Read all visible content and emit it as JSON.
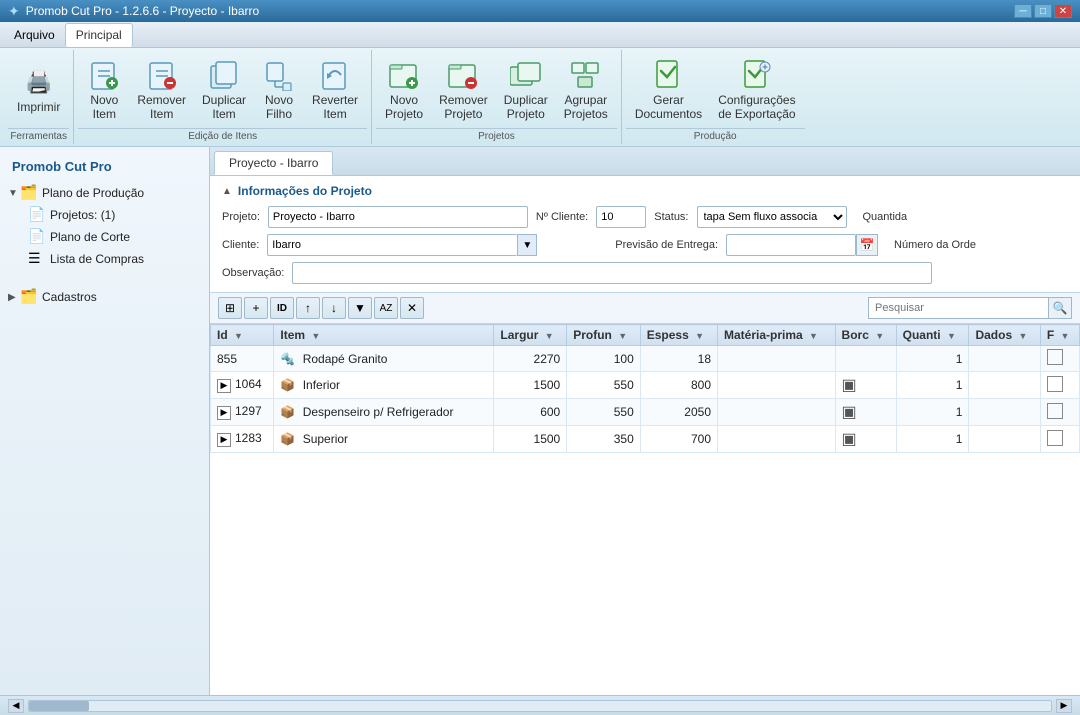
{
  "app": {
    "title": "Promob Cut Pro - 1.2.6.6 - Proyecto - Ibarro",
    "icon": "✦"
  },
  "titlebar": {
    "minimize": "─",
    "maximize": "□",
    "close": "✕"
  },
  "menu": {
    "items": [
      {
        "id": "arquivo",
        "label": "Arquivo"
      },
      {
        "id": "principal",
        "label": "Principal"
      }
    ]
  },
  "toolbar": {
    "sections": [
      {
        "id": "ferramentas",
        "label": "Ferramentas",
        "buttons": [
          {
            "id": "imprimir",
            "label": "Imprimir",
            "icon": "🖨️"
          }
        ]
      },
      {
        "id": "edicao-itens",
        "label": "Edição de Itens",
        "buttons": [
          {
            "id": "novo-item",
            "label": "Novo Item",
            "icon": "📄"
          },
          {
            "id": "remover-item",
            "label": "Remover Item",
            "icon": "📄"
          },
          {
            "id": "duplicar-item",
            "label": "Duplicar Item",
            "icon": "📄"
          },
          {
            "id": "novo-filho",
            "label": "Novo Filho",
            "icon": "📄"
          },
          {
            "id": "reverter-item",
            "label": "Reverter Item",
            "icon": "📄"
          }
        ]
      },
      {
        "id": "projetos",
        "label": "Projetos",
        "buttons": [
          {
            "id": "novo-projeto",
            "label": "Novo Projeto",
            "icon": "📋"
          },
          {
            "id": "remover-projeto",
            "label": "Remover Projeto",
            "icon": "📋"
          },
          {
            "id": "duplicar-projeto",
            "label": "Duplicar Projeto",
            "icon": "📋"
          },
          {
            "id": "agrupar-projetos",
            "label": "Agrupar Projetos",
            "icon": "📋"
          }
        ]
      },
      {
        "id": "producao",
        "label": "Produção",
        "buttons": [
          {
            "id": "gerar-documentos",
            "label": "Gerar Documentos",
            "icon": "📊"
          },
          {
            "id": "config-exportacao",
            "label": "Configurações de Exportação",
            "icon": "📊"
          }
        ]
      }
    ]
  },
  "sidebar": {
    "title": "Promob Cut Pro",
    "tree": [
      {
        "id": "plano-producao",
        "label": "Plano de Produção",
        "level": 0,
        "type": "folder",
        "expanded": true
      },
      {
        "id": "projetos",
        "label": "Projetos: (1)",
        "level": 1,
        "type": "file"
      },
      {
        "id": "plano-corte",
        "label": "Plano de Corte",
        "level": 1,
        "type": "file"
      },
      {
        "id": "lista-compras",
        "label": "Lista de Compras",
        "level": 1,
        "type": "list"
      },
      {
        "id": "cadastros",
        "label": "Cadastros",
        "level": 0,
        "type": "folder",
        "expanded": false
      }
    ]
  },
  "main": {
    "tab": "Proyecto - Ibarro",
    "form": {
      "section_title": "Informações do Projeto",
      "fields": {
        "projeto_label": "Projeto:",
        "projeto_value": "Proyecto - Ibarro",
        "no_cliente_label": "Nº Cliente:",
        "no_cliente_value": "10",
        "status_label": "Status:",
        "status_value": "tapa Sem fluxo associa",
        "quantidade_label": "Quantida",
        "cliente_label": "Cliente:",
        "cliente_value": "Ibarro",
        "previsao_label": "Previsão de Entrega:",
        "numero_ordem_label": "Número da Orde",
        "observacao_label": "Observação:"
      }
    },
    "table": {
      "search_placeholder": "Pesquisar",
      "columns": [
        {
          "id": "id",
          "label": "Id"
        },
        {
          "id": "item",
          "label": "Item"
        },
        {
          "id": "largur",
          "label": "Largur"
        },
        {
          "id": "profun",
          "label": "Profun"
        },
        {
          "id": "espess",
          "label": "Espess"
        },
        {
          "id": "materia-prima",
          "label": "Matéria-prima"
        },
        {
          "id": "borc",
          "label": "Borc"
        },
        {
          "id": "quanti",
          "label": "Quanti"
        },
        {
          "id": "dados",
          "label": "Dados"
        },
        {
          "id": "flag",
          "label": "F"
        }
      ],
      "rows": [
        {
          "id": "855",
          "item": "Rodapé Granito",
          "largur": "2270",
          "profun": "100",
          "espess": "18",
          "materia": "",
          "borc": "",
          "quanti": "1",
          "dados": "",
          "flag": false,
          "expand": false,
          "icon": "🔩"
        },
        {
          "id": "1064",
          "item": "Inferior",
          "largur": "1500",
          "profun": "550",
          "espess": "800",
          "materia": "",
          "borc": "▣",
          "quanti": "1",
          "dados": "",
          "flag": false,
          "expand": true,
          "icon": "📦"
        },
        {
          "id": "1297",
          "item": "Despenseiro p/ Refrigerador",
          "largur": "600",
          "profun": "550",
          "espess": "2050",
          "materia": "",
          "borc": "▣",
          "quanti": "1",
          "dados": "",
          "flag": false,
          "expand": true,
          "icon": "📦"
        },
        {
          "id": "1283",
          "item": "Superior",
          "largur": "1500",
          "profun": "350",
          "espess": "700",
          "materia": "",
          "borc": "▣",
          "quanti": "1",
          "dados": "",
          "flag": false,
          "expand": true,
          "icon": "📦"
        }
      ],
      "toolbar_buttons": [
        {
          "id": "tbl-copy",
          "icon": "⊞",
          "label": ""
        },
        {
          "id": "tbl-add",
          "icon": "+",
          "label": ""
        },
        {
          "id": "tbl-id",
          "icon": "ID",
          "label": ""
        },
        {
          "id": "tbl-up",
          "icon": "↑",
          "label": ""
        },
        {
          "id": "tbl-down",
          "icon": "↓",
          "label": ""
        },
        {
          "id": "tbl-filter",
          "icon": "▼",
          "label": ""
        },
        {
          "id": "tbl-az",
          "icon": "AZ",
          "label": ""
        },
        {
          "id": "tbl-clear",
          "icon": "✕",
          "label": ""
        }
      ]
    }
  },
  "statusbar": {
    "text": ""
  }
}
